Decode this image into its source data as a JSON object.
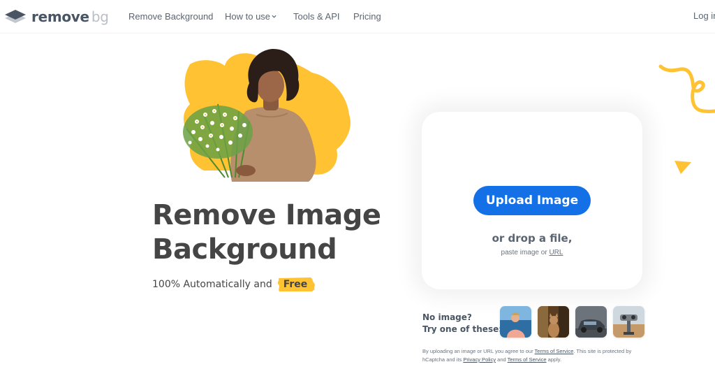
{
  "nav": {
    "logo_primary": "remove",
    "logo_secondary": "bg",
    "links": [
      {
        "label": "Remove Background"
      },
      {
        "label": "How to use",
        "has_dropdown": true
      },
      {
        "label": "Tools & API"
      },
      {
        "label": "Pricing"
      }
    ],
    "login_label": "Log in"
  },
  "hero": {
    "headline_line1": "Remove Image",
    "headline_line2": "Background",
    "sub_text": "100% Automatically and",
    "free_badge": "Free",
    "image_alt": "woman holding bouquet of chamomile flowers"
  },
  "upload": {
    "button_label": "Upload Image",
    "drop_text": "or drop a file,",
    "paste_prefix": "paste image or",
    "url_link": "URL"
  },
  "samples": {
    "line1": "No image?",
    "line2": "Try one of these:",
    "items": [
      {
        "name": "person"
      },
      {
        "name": "cat"
      },
      {
        "name": "car"
      },
      {
        "name": "binoculars"
      }
    ]
  },
  "legal": {
    "part1": "By uploading an image or URL you agree to our",
    "tos_link": "Terms of Service",
    "part2": ". This site is protected by hCaptcha and its",
    "privacy_link": "Privacy Policy",
    "part3": "and",
    "tos_link2": "Terms of Service",
    "part4": "apply."
  },
  "colors": {
    "accent_blue": "#1470e6",
    "accent_yellow": "#ffc233",
    "text_dark": "#454545"
  }
}
